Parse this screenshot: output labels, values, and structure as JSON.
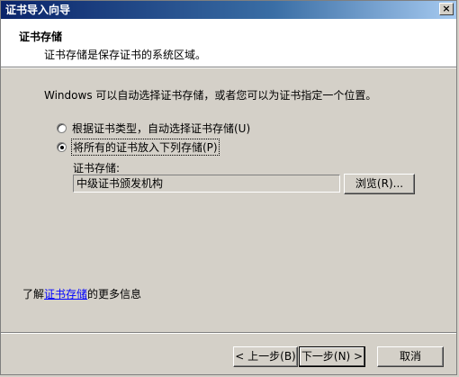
{
  "window": {
    "title": "证书导入向导",
    "close_symbol": "×"
  },
  "header": {
    "title": "证书存储",
    "subtitle": "证书存储是保存证书的系统区域。"
  },
  "body": {
    "intro": "Windows 可以自动选择证书存储，或者您可以为证书指定一个位置。",
    "options": [
      {
        "label": "根据证书类型，自动选择证书存储(U)",
        "checked": false
      },
      {
        "label": "将所有的证书放入下列存储(P)",
        "checked": true
      }
    ],
    "store_label": "证书存储:",
    "store_value": "中级证书颁发机构",
    "browse_label": "浏览(R)...",
    "learn_prefix": "了解",
    "learn_link": "证书存储",
    "learn_suffix": "的更多信息"
  },
  "footer": {
    "back_label": "< 上一步(B)",
    "next_label": "下一步(N) >",
    "cancel_label": "取消"
  }
}
